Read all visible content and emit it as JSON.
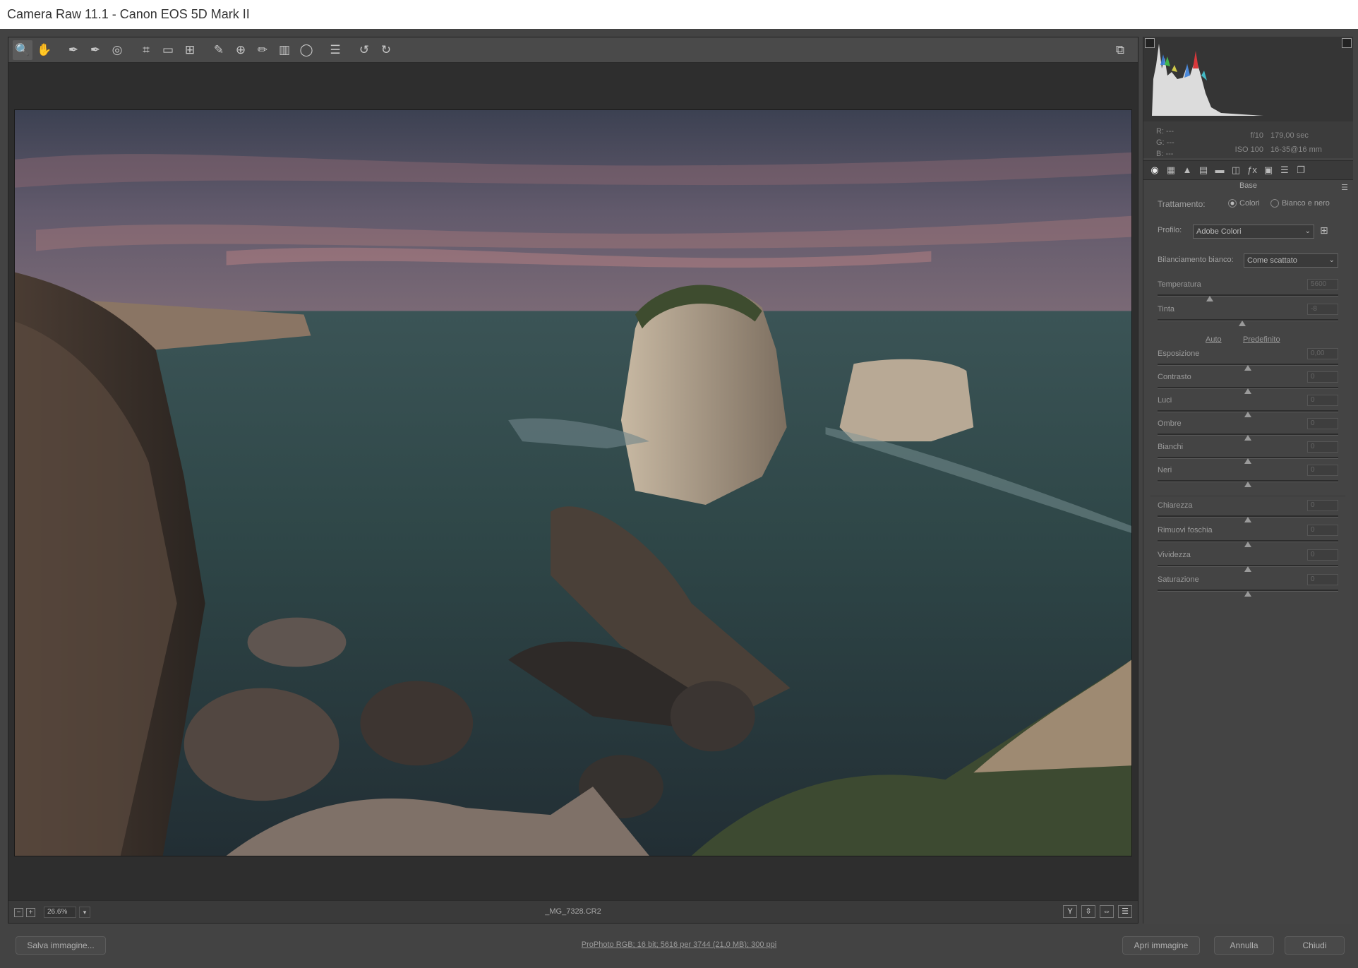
{
  "window": {
    "title": "Camera Raw 11.1  -  Canon EOS 5D Mark II"
  },
  "toolbar": {
    "tools": [
      {
        "name": "zoom-icon",
        "glyph": "🔍"
      },
      {
        "name": "hand-icon",
        "glyph": "✋"
      },
      {
        "name": "white-balance-icon",
        "glyph": "✒"
      },
      {
        "name": "color-sampler-icon",
        "glyph": "✒"
      },
      {
        "name": "targeted-adjust-icon",
        "glyph": "◎"
      },
      {
        "name": "crop-icon",
        "glyph": "⌗"
      },
      {
        "name": "straighten-icon",
        "glyph": "▭"
      },
      {
        "name": "transform-icon",
        "glyph": "⊞"
      },
      {
        "name": "spot-removal-icon",
        "glyph": "✎"
      },
      {
        "name": "red-eye-icon",
        "glyph": "⊕"
      },
      {
        "name": "adjustment-brush-icon",
        "glyph": "✏"
      },
      {
        "name": "graduated-filter-icon",
        "glyph": "▥"
      },
      {
        "name": "radial-filter-icon",
        "glyph": "◯"
      },
      {
        "name": "preferences-icon",
        "glyph": "☰"
      },
      {
        "name": "rotate-left-icon",
        "glyph": "↺"
      },
      {
        "name": "rotate-right-icon",
        "glyph": "↻"
      }
    ],
    "fullscreen_glyph": "⧉"
  },
  "status": {
    "zoom_minus": "−",
    "zoom_plus": "+",
    "zoom": "26.6%",
    "zoom_arrow": "▾",
    "filename": "_MG_7328.CR2",
    "view_buttons": [
      "Y",
      "⇳",
      "⇔",
      "☰"
    ]
  },
  "info": {
    "r": "R:   ---",
    "g": "G:   ---",
    "b": "B:   ---",
    "aperture": "f/10",
    "shutter": "179,00 sec",
    "iso": "ISO 100",
    "lens": "16-35@16 mm"
  },
  "tabs": [
    "◉",
    "▦",
    "▲",
    "▤",
    "▬",
    "◫",
    "ƒx",
    "▣",
    "☰",
    "❐"
  ],
  "panel": {
    "title": "Base",
    "menu": "☰",
    "treatment_label": "Trattamento:",
    "treatment_color": "Colori",
    "treatment_bw": "Bianco e nero",
    "profile_label": "Profilo:",
    "profile_value": "Adobe Colori",
    "profile_grid_glyph": "⊞",
    "wb_label": "Bilanciamento bianco:",
    "wb_value": "Come scattato",
    "dropdown_arrow": "⌄",
    "auto": "Auto",
    "default": "Predefinito"
  },
  "sliders": [
    {
      "label": "Temperatura",
      "value": "5600",
      "pos": 0.29
    },
    {
      "label": "Tinta",
      "value": "-8",
      "pos": 0.47
    },
    {
      "label": "Esposizione",
      "value": "0,00",
      "pos": 0.5
    },
    {
      "label": "Contrasto",
      "value": "0",
      "pos": 0.5
    },
    {
      "label": "Luci",
      "value": "0",
      "pos": 0.5
    },
    {
      "label": "Ombre",
      "value": "0",
      "pos": 0.5
    },
    {
      "label": "Bianchi",
      "value": "0",
      "pos": 0.5
    },
    {
      "label": "Neri",
      "value": "0",
      "pos": 0.5
    },
    {
      "label": "Chiarezza",
      "value": "0",
      "pos": 0.5
    },
    {
      "label": "Rimuovi foschia",
      "value": "0",
      "pos": 0.5
    },
    {
      "label": "Vividezza",
      "value": "0",
      "pos": 0.5
    },
    {
      "label": "Saturazione",
      "value": "0",
      "pos": 0.5
    }
  ],
  "bottom": {
    "save": "Salva immagine...",
    "workflow": "ProPhoto RGB; 16 bit; 5616 per 3744 (21,0 MB); 300 ppi",
    "open": "Apri immagine",
    "cancel": "Annulla",
    "close": "Chiudi"
  }
}
